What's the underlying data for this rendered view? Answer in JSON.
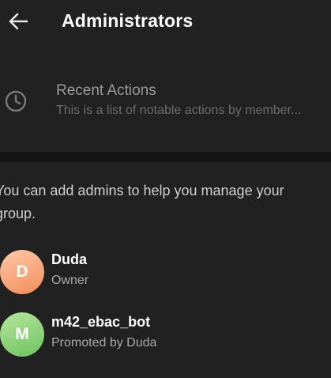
{
  "header": {
    "back_icon": "arrow-left-icon",
    "title": "Administrators"
  },
  "recent_actions": {
    "icon": "clock-icon",
    "title": "Recent Actions",
    "subtitle": "This is a list of notable actions by member..."
  },
  "info_text": "You can add admins to help you manage your group.",
  "admins": [
    {
      "initial": "D",
      "name": "Duda",
      "role": "Owner",
      "avatar_color": "#f79a6a"
    },
    {
      "initial": "M",
      "name": "m42_ebac_bot",
      "role": "Promoted by Duda",
      "avatar_color": "#7ccd6b"
    }
  ],
  "colors": {
    "background": "#212121",
    "divider": "#141414",
    "primary_text": "#ffffff",
    "secondary_text": "#a8a8a8"
  }
}
